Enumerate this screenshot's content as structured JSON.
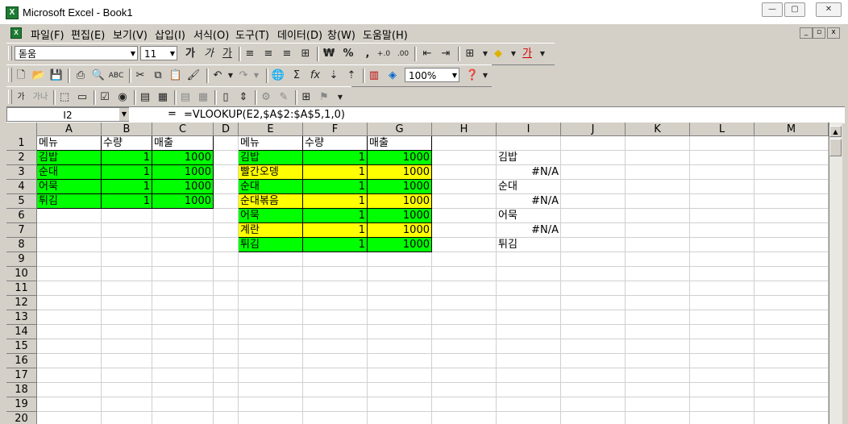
{
  "window": {
    "title": "Microsoft Excel - Book1",
    "app_icon_glyph": "X",
    "minimize": "—",
    "restore": "▢",
    "close": "✕"
  },
  "menu": {
    "items": [
      "파일(F)",
      "편집(E)",
      "보기(V)",
      "삽입(I)",
      "서식(O)",
      "도구(T)",
      "데이터(D)",
      "창(W)",
      "도움말(H)"
    ],
    "mdi_min": "_",
    "mdi_restore": "▫",
    "mdi_close": "x"
  },
  "format_toolbar": {
    "font_name": "돋움",
    "font_size": "11",
    "bold": "가",
    "italic": "가",
    "underline": "가",
    "currency": "₩",
    "percent": "%",
    "comma": ",",
    "inc_decimal": "+.0",
    "dec_decimal": ".00",
    "font_color_glyph": "가"
  },
  "standard_toolbar": {
    "zoom": "100%",
    "sigma": "Σ",
    "fx": "fx"
  },
  "forms_toolbar": {
    "label1": "가",
    "label2": "가나"
  },
  "formula_bar": {
    "name_box": "I2",
    "equals": "=",
    "formula": "=VLOOKUP(E2,$A$2:$A$5,1,0)"
  },
  "sheet": {
    "columns": [
      "A",
      "B",
      "C",
      "D",
      "E",
      "F",
      "G",
      "H",
      "I",
      "J",
      "K",
      "L",
      "M"
    ],
    "rows": [
      "1",
      "2",
      "3",
      "4",
      "5",
      "6",
      "7",
      "8",
      "9",
      "10",
      "11",
      "12",
      "13",
      "14",
      "15",
      "16",
      "17",
      "18",
      "19",
      "20"
    ],
    "table1": {
      "headers": [
        "메뉴",
        "수량",
        "매출"
      ],
      "rows": [
        [
          "김밥",
          "1",
          "1000"
        ],
        [
          "순대",
          "1",
          "1000"
        ],
        [
          "어묵",
          "1",
          "1000"
        ],
        [
          "튀김",
          "1",
          "1000"
        ]
      ]
    },
    "table2": {
      "headers": [
        "메뉴",
        "수량",
        "매출"
      ],
      "rows": [
        [
          "김밥",
          "1",
          "1000"
        ],
        [
          "빨간오뎅",
          "1",
          "1000"
        ],
        [
          "순대",
          "1",
          "1000"
        ],
        [
          "순대볶음",
          "1",
          "1000"
        ],
        [
          "어묵",
          "1",
          "1000"
        ],
        [
          "계란",
          "1",
          "1000"
        ],
        [
          "튀김",
          "1",
          "1000"
        ]
      ],
      "row_fill": [
        "green",
        "yellow",
        "green",
        "yellow",
        "green",
        "yellow",
        "green"
      ]
    },
    "col_i": [
      "김밥",
      "#N/A",
      "순대",
      "#N/A",
      "어묵",
      "#N/A",
      "튀김"
    ],
    "fill_colors": {
      "green": "#00ff00",
      "yellow": "#ffff00"
    }
  }
}
